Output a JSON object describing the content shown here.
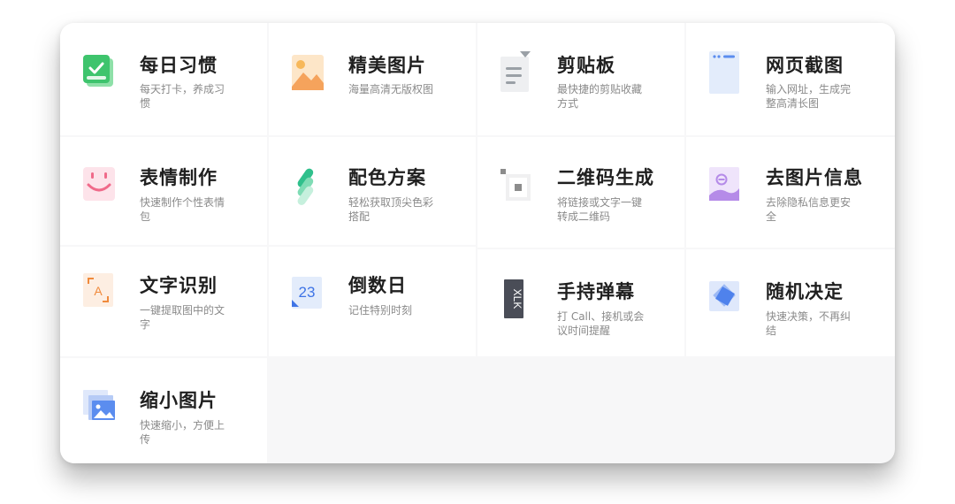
{
  "tools": [
    {
      "title": "每日习惯",
      "desc": "每天打卡，养成习惯",
      "icon": "calendar-check-icon"
    },
    {
      "title": "精美图片",
      "desc": "海量高清无版权图",
      "icon": "image-icon"
    },
    {
      "title": "剪贴板",
      "desc": "最快捷的剪贴收藏方式",
      "icon": "clipboard-icon"
    },
    {
      "title": "网页截图",
      "desc": "输入网址，生成完整高清长图",
      "icon": "webpage-screenshot-icon"
    },
    {
      "title": "表情制作",
      "desc": "快速制作个性表情包",
      "icon": "smiley-icon"
    },
    {
      "title": "配色方案",
      "desc": "轻松获取顶尖色彩搭配",
      "icon": "color-palette-icon"
    },
    {
      "title": "二维码生成",
      "desc": "将链接或文字一键转成二维码",
      "icon": "qr-code-icon"
    },
    {
      "title": "去图片信息",
      "desc": "去除隐私信息更安全",
      "icon": "image-info-remove-icon"
    },
    {
      "title": "文字识别",
      "desc": "一键提取图中的文字",
      "icon": "text-recognition-icon"
    },
    {
      "title": "倒数日",
      "desc": "记住特别时刻",
      "icon": "countdown-icon",
      "icon_text": "23"
    },
    {
      "title": "手持弹幕",
      "desc": "打 Call、接机或会议时间提醒",
      "icon": "danmaku-icon",
      "icon_text": "XLK"
    },
    {
      "title": "随机决定",
      "desc": "快速决策，不再纠结",
      "icon": "random-decide-icon"
    },
    {
      "title": "缩小图片",
      "desc": "快速缩小，方便上传",
      "icon": "image-compress-icon"
    }
  ],
  "colors": {
    "green": "#3ec46d",
    "orange": "#f5a35c",
    "gray": "#9aa0a6",
    "blue": "#5b8def",
    "pink": "#f06a8a",
    "teal": "#2fc08c",
    "purple": "#b58be8"
  }
}
